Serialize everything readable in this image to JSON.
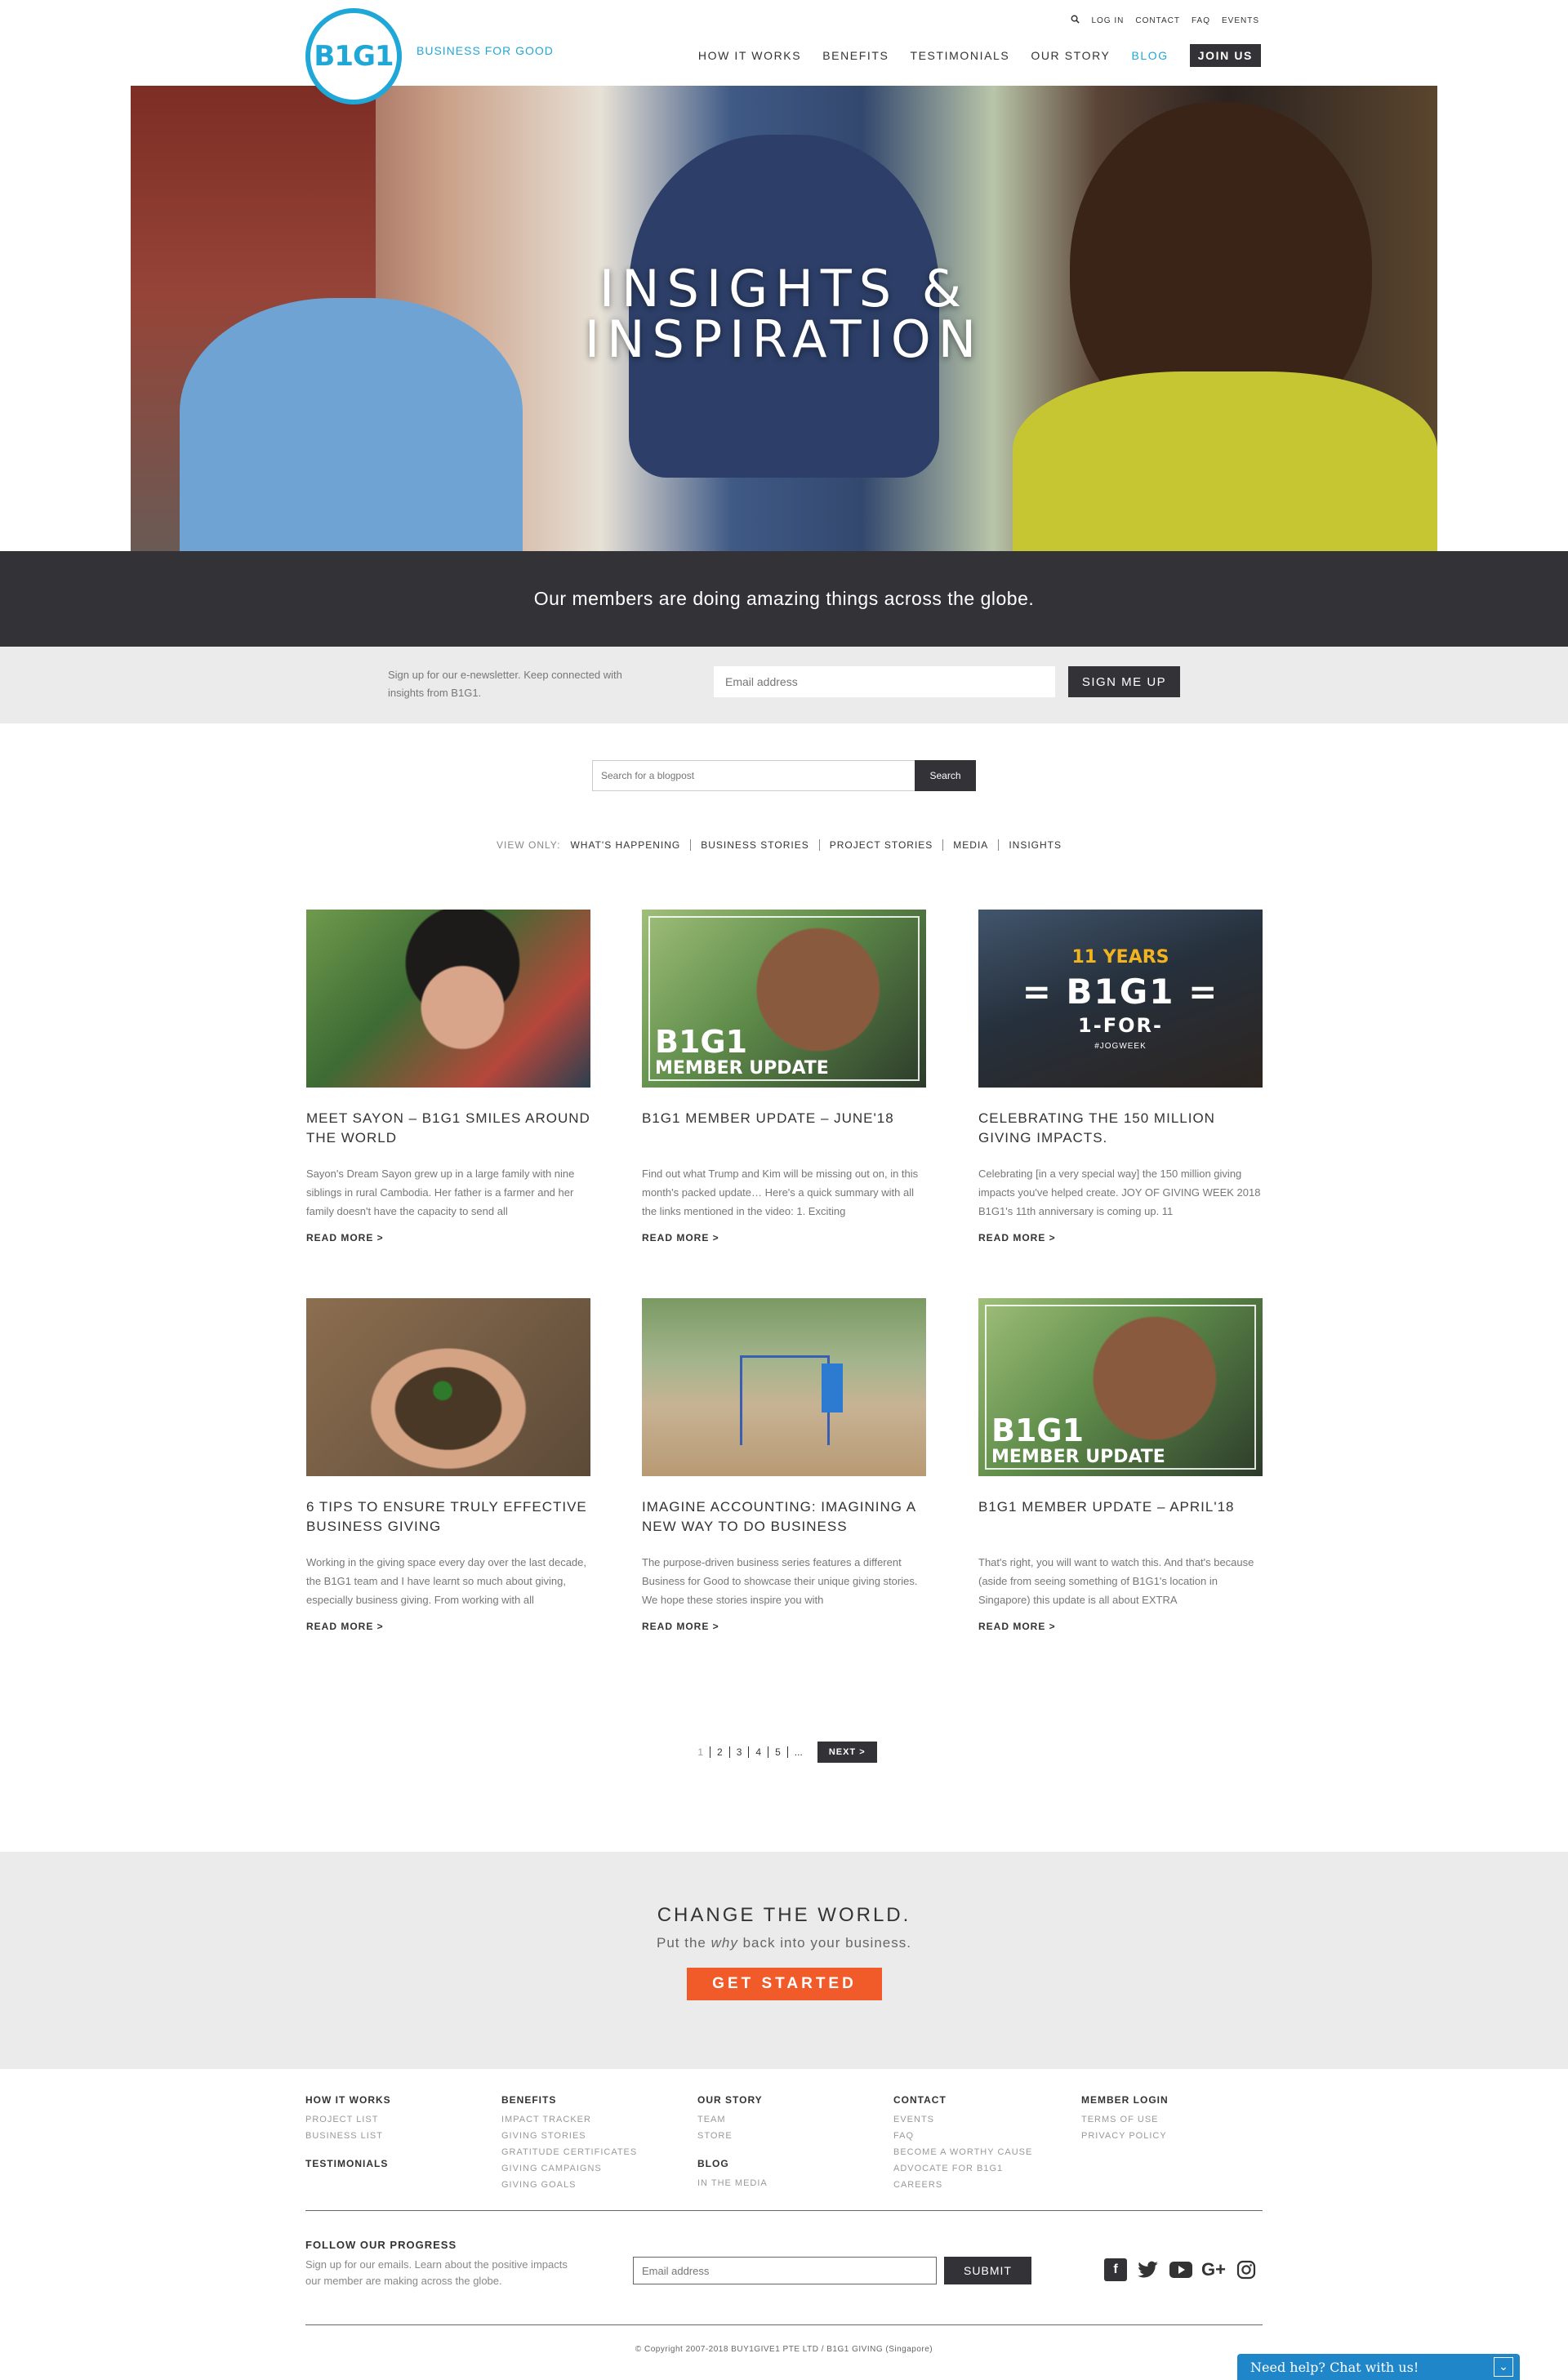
{
  "header": {
    "logo_text": "B1G1",
    "tagline": "BUSINESS FOR GOOD",
    "util_nav": [
      "LOG IN",
      "CONTACT",
      "FAQ",
      "EVENTS"
    ],
    "main_nav": [
      "HOW IT WORKS",
      "BENEFITS",
      "TESTIMONIALS",
      "OUR STORY",
      "BLOG"
    ],
    "join_label": "JOIN US",
    "accent_color": "#1fa7d8"
  },
  "hero": {
    "title_line1": "INSIGHTS &",
    "title_line2": "INSPIRATION"
  },
  "banner": {
    "text": "Our members are doing amazing things across the globe."
  },
  "newsletter": {
    "copy": "Sign up for our e-newsletter. Keep connected with insights from B1G1.",
    "placeholder": "Email address",
    "button": "SIGN ME UP"
  },
  "search": {
    "placeholder": "Search for a blogpost",
    "button": "Search"
  },
  "filter": {
    "label": "VIEW ONLY:",
    "items": [
      "WHAT'S HAPPENING",
      "BUSINESS STORIES",
      "PROJECT STORIES",
      "MEDIA",
      "INSIGHTS"
    ]
  },
  "posts": [
    {
      "title": "MEET SAYON – B1G1 SMILES AROUND THE WORLD",
      "excerpt": "Sayon's Dream Sayon grew up in a large family with nine siblings in rural Cambodia. Her father is a farmer and her family doesn't have the capacity to send all",
      "read_more": "READ MORE >"
    },
    {
      "title": "B1G1 MEMBER UPDATE – JUNE'18",
      "excerpt": " Find out what Trump and Kim will be missing out on, in this month's packed update… Here's a quick summary with all the links mentioned in the video: 1. Exciting",
      "read_more": "READ MORE >",
      "overlay_big": "B1G1",
      "overlay_small": "MEMBER UPDATE"
    },
    {
      "title": "CELEBRATING THE 150 MILLION GIVING IMPACTS.",
      "excerpt": "  Celebrating [in a very special way] the 150 million giving impacts you've helped create.  JOY OF GIVING WEEK 2018 B1G1's 11th anniversary is coming up. 11",
      "read_more": "READ MORE >",
      "overlay_years": "11 YEARS",
      "overlay_b1g1": "= B1G1 =",
      "overlay_for": "1-FOR-",
      "overlay_tag": "#JOGWEEK"
    },
    {
      "title": "6 TIPS TO ENSURE TRULY EFFECTIVE BUSINESS GIVING",
      "excerpt": "Working in the giving space every day over the last decade, the B1G1 team and I have learnt so much about giving, especially business giving. From working with all",
      "read_more": "READ MORE >"
    },
    {
      "title": "IMAGINE ACCOUNTING: IMAGINING A NEW WAY TO DO BUSINESS",
      "excerpt": "The purpose-driven business series features a different Business for Good to showcase their unique giving stories. We hope these stories inspire you with",
      "read_more": "READ MORE >"
    },
    {
      "title": "B1G1 MEMBER UPDATE – APRIL'18",
      "excerpt": "That's right, you will want to watch this. And that's because (aside from seeing something of B1G1's location in Singapore) this update is all about EXTRA",
      "read_more": "READ MORE >",
      "overlay_big": "B1G1",
      "overlay_small": "MEMBER UPDATE"
    }
  ],
  "pagination": {
    "pages": [
      "1",
      "2",
      "3",
      "4",
      "5",
      "..."
    ],
    "next": "NEXT >"
  },
  "cta": {
    "title": "CHANGE THE WORLD.",
    "sub_before": "Put the ",
    "sub_em": "why",
    "sub_after": " back into your business.",
    "button": "GET STARTED",
    "button_color": "#f15b2a"
  },
  "footer": {
    "col1": {
      "heading": "HOW IT WORKS",
      "links": [
        "PROJECT LIST",
        "BUSINESS LIST"
      ],
      "heading2": "TESTIMONIALS"
    },
    "col2": {
      "heading": "BENEFITS",
      "links": [
        "IMPACT TRACKER",
        "GIVING STORIES",
        "GRATITUDE CERTIFICATES",
        "GIVING CAMPAIGNS",
        "GIVING GOALS"
      ]
    },
    "col3": {
      "heading": "OUR STORY",
      "links": [
        "TEAM",
        "STORE"
      ],
      "heading2": "BLOG",
      "links2": [
        "IN THE MEDIA"
      ]
    },
    "col4": {
      "heading": "CONTACT",
      "links": [
        "EVENTS",
        "FAQ",
        "BECOME A WORTHY CAUSE",
        "ADVOCATE FOR B1G1",
        "CAREERS"
      ]
    },
    "col5": {
      "heading": "MEMBER LOGIN",
      "links": [
        "TERMS OF USE",
        "PRIVACY POLICY"
      ]
    },
    "follow_title": "FOLLOW OUR PROGRESS",
    "follow_copy": "Sign up for our emails. Learn about the positive impacts our member are making across the globe.",
    "follow_placeholder": "Email address",
    "follow_button": "SUBMIT",
    "social": [
      "facebook-icon",
      "twitter-icon",
      "youtube-icon",
      "google-plus-icon",
      "instagram-icon"
    ],
    "copyright": "© Copyright 2007-2018 BUY1GIVE1 PTE LTD / B1G1 GIVING (Singapore)"
  },
  "chat": {
    "label": "Need help? Chat with us!"
  }
}
